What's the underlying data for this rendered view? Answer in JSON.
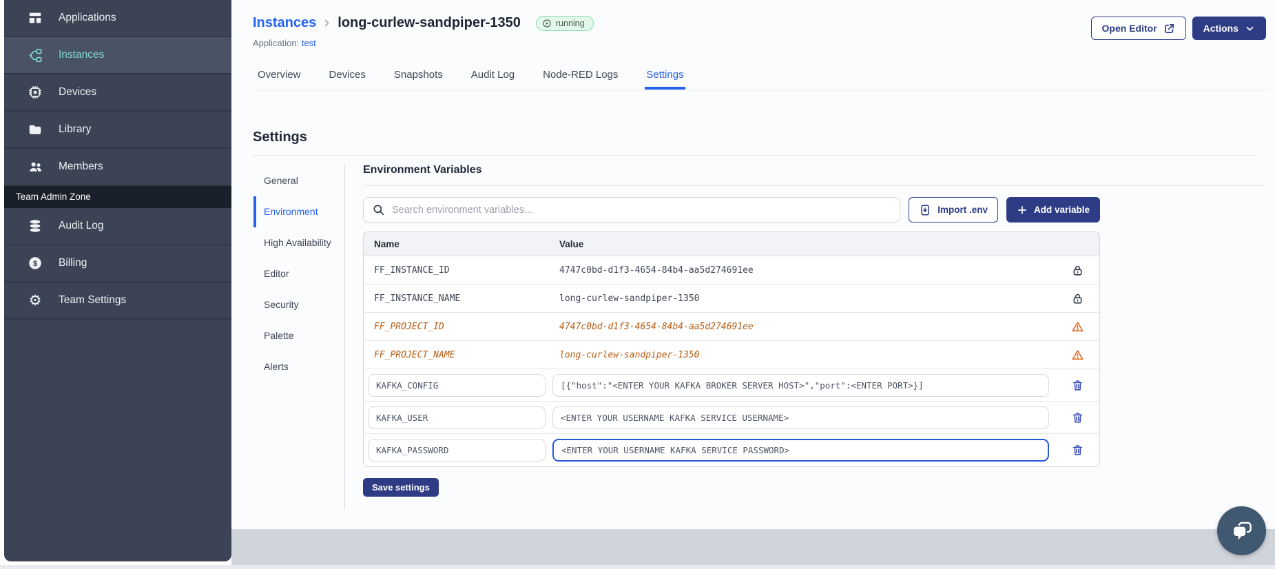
{
  "sidebar": {
    "items": [
      {
        "label": "Applications"
      },
      {
        "label": "Instances"
      },
      {
        "label": "Devices"
      },
      {
        "label": "Library"
      },
      {
        "label": "Members"
      }
    ],
    "section_label": "Team Admin Zone",
    "admin_items": [
      {
        "label": "Audit Log"
      },
      {
        "label": "Billing"
      },
      {
        "label": "Team Settings"
      }
    ]
  },
  "header": {
    "breadcrumb_parent": "Instances",
    "breadcrumb_current": "long-curlew-sandpiper-1350",
    "status_badge": "running",
    "application_label": "Application:",
    "application_name": "test",
    "open_editor_label": "Open Editor",
    "actions_label": "Actions"
  },
  "tabs": [
    {
      "label": "Overview"
    },
    {
      "label": "Devices"
    },
    {
      "label": "Snapshots"
    },
    {
      "label": "Audit Log"
    },
    {
      "label": "Node-RED Logs"
    },
    {
      "label": "Settings"
    }
  ],
  "settings": {
    "page_title": "Settings",
    "nav": [
      {
        "label": "General"
      },
      {
        "label": "Environment"
      },
      {
        "label": "High Availability"
      },
      {
        "label": "Editor"
      },
      {
        "label": "Security"
      },
      {
        "label": "Palette"
      },
      {
        "label": "Alerts"
      }
    ],
    "section_title": "Environment Variables",
    "search_placeholder": "Search environment variables...",
    "import_button": "Import .env",
    "add_button": "Add variable",
    "save_button": "Save settings",
    "table": {
      "columns": [
        "Name",
        "Value"
      ],
      "rows": [
        {
          "name": "FF_INSTANCE_ID",
          "value": "4747c0bd-d1f3-4654-84b4-aa5d274691ee",
          "type": "locked"
        },
        {
          "name": "FF_INSTANCE_NAME",
          "value": "long-curlew-sandpiper-1350",
          "type": "locked"
        },
        {
          "name": "FF_PROJECT_ID",
          "value": "4747c0bd-d1f3-4654-84b4-aa5d274691ee",
          "type": "deprecated"
        },
        {
          "name": "FF_PROJECT_NAME",
          "value": "long-curlew-sandpiper-1350",
          "type": "deprecated"
        },
        {
          "name": "KAFKA_CONFIG",
          "value": "[{\"host\":\"<ENTER YOUR KAFKA BROKER SERVER HOST>\",\"port\":<ENTER PORT>}]",
          "type": "editable"
        },
        {
          "name": "KAFKA_USER",
          "value": "<ENTER YOUR USERNAME KAFKA SERVICE USERNAME>",
          "type": "editable"
        },
        {
          "name": "KAFKA_PASSWORD",
          "value": "<ENTER YOUR USERNAME KAFKA SERVICE PASSWORD>",
          "type": "editable",
          "focused": true
        }
      ]
    }
  },
  "colors": {
    "accent_blue": "#2563eb",
    "navy_button": "#2d3c85",
    "sidebar_bg": "#3b4354",
    "sidebar_active_text": "#7fd8cd",
    "deprecated_orange": "#b85c12",
    "warning_orange": "#e0651c",
    "trash_blue": "#3d52b5",
    "running_badge_bg": "#e1f8eb",
    "running_badge_border": "#8adbaa",
    "footer_band": "#d0d4db",
    "chat_bubble_bg": "#405870"
  }
}
